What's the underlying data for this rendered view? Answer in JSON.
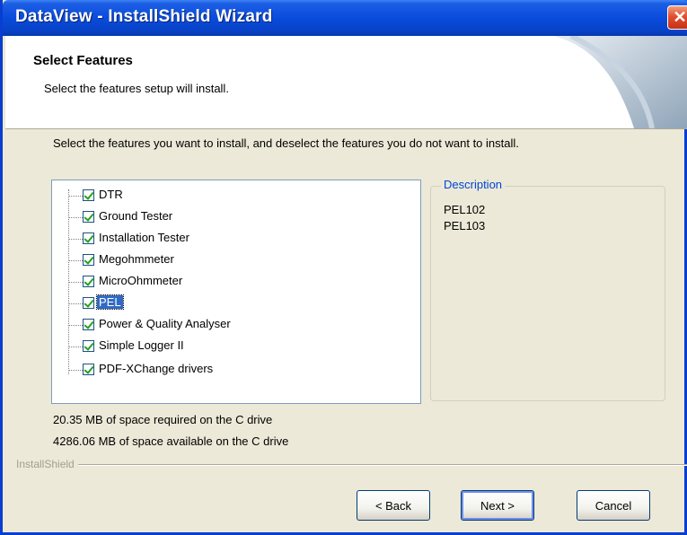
{
  "window": {
    "title": "DataView - InstallShield Wizard",
    "close_icon": "close-icon"
  },
  "header": {
    "title": "Select Features",
    "subtitle": "Select the features setup will install."
  },
  "instruction": "Select the features you want to install, and deselect the features you do not want to install.",
  "features": [
    {
      "label": "DTR",
      "checked": true,
      "selected": false
    },
    {
      "label": "Ground Tester",
      "checked": true,
      "selected": false
    },
    {
      "label": "Installation Tester",
      "checked": true,
      "selected": false
    },
    {
      "label": "Megohmmeter",
      "checked": true,
      "selected": false
    },
    {
      "label": "MicroOhmmeter",
      "checked": true,
      "selected": false
    },
    {
      "label": "PEL",
      "checked": true,
      "selected": true
    },
    {
      "label": "Power & Quality Analyser",
      "checked": true,
      "selected": false
    },
    {
      "label": "Simple Logger II",
      "checked": true,
      "selected": false
    },
    {
      "label": "PDF-XChange drivers",
      "checked": true,
      "selected": false
    }
  ],
  "description": {
    "legend": "Description",
    "lines": [
      "PEL102",
      "PEL103"
    ]
  },
  "space": {
    "required": "20.35 MB of space required on the C drive",
    "available": "4286.06 MB of space available on the C drive"
  },
  "brand": "InstallShield",
  "buttons": {
    "back": "< Back",
    "next": "Next >",
    "cancel": "Cancel"
  },
  "colors": {
    "titlebar": "#0a4bdc",
    "selection": "#316ac5",
    "check": "#21a121",
    "dialog_bg": "#ece9d8"
  }
}
